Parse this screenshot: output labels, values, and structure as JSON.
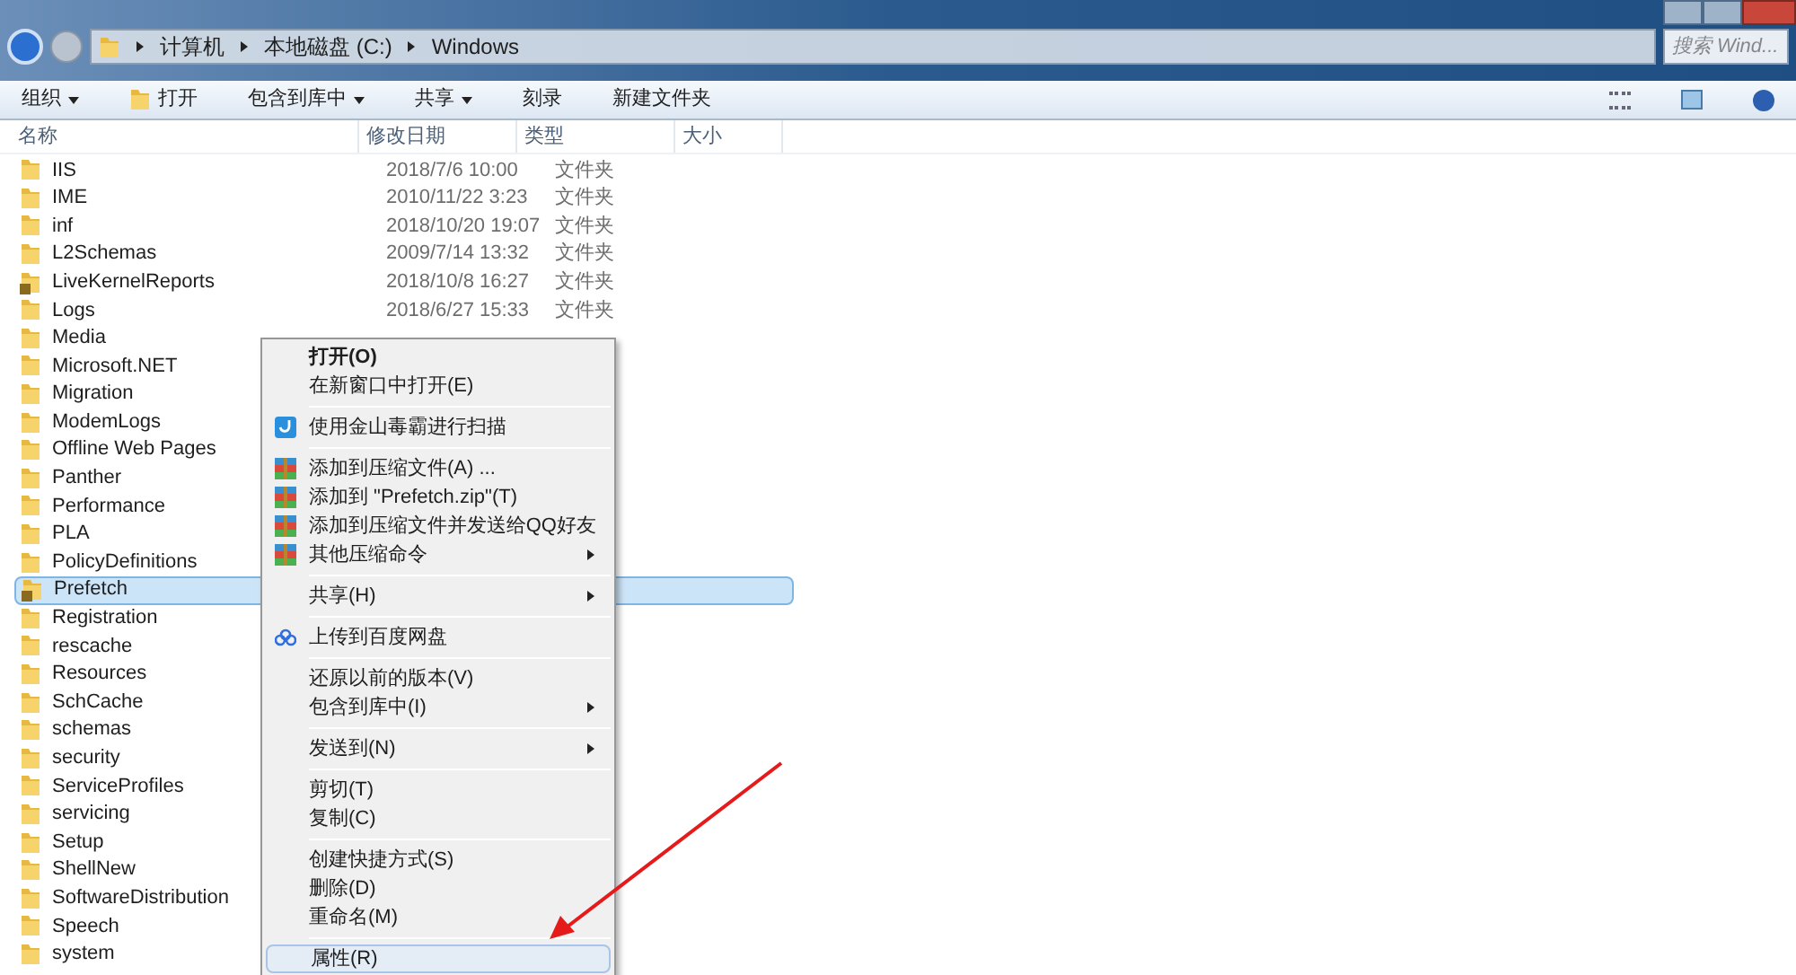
{
  "breadcrumb": [
    "计算机",
    "本地磁盘 (C:)",
    "Windows"
  ],
  "search": {
    "placeholder": "搜索 Wind..."
  },
  "toolbar": [
    {
      "label": "组织",
      "dropdown": true,
      "icon": false
    },
    {
      "label": "打开",
      "dropdown": false,
      "icon": true
    },
    {
      "label": "包含到库中",
      "dropdown": true,
      "icon": false
    },
    {
      "label": "共享",
      "dropdown": true,
      "icon": false
    },
    {
      "label": "刻录",
      "dropdown": false,
      "icon": false
    },
    {
      "label": "新建文件夹",
      "dropdown": false,
      "icon": false
    }
  ],
  "columns": [
    "名称",
    "修改日期",
    "类型",
    "大小"
  ],
  "rows": [
    {
      "name": "IIS",
      "date": "2018/7/6 10:00",
      "type": "文件夹",
      "locked": false,
      "selected": false
    },
    {
      "name": "IME",
      "date": "2010/11/22 3:23",
      "type": "文件夹",
      "locked": false,
      "selected": false
    },
    {
      "name": "inf",
      "date": "2018/10/20 19:07",
      "type": "文件夹",
      "locked": false,
      "selected": false
    },
    {
      "name": "L2Schemas",
      "date": "2009/7/14 13:32",
      "type": "文件夹",
      "locked": false,
      "selected": false
    },
    {
      "name": "LiveKernelReports",
      "date": "2018/10/8 16:27",
      "type": "文件夹",
      "locked": true,
      "selected": false
    },
    {
      "name": "Logs",
      "date": "2018/6/27 15:33",
      "type": "文件夹",
      "locked": false,
      "selected": false
    },
    {
      "name": "Media",
      "locked": false,
      "selected": false
    },
    {
      "name": "Microsoft.NET",
      "locked": false,
      "selected": false
    },
    {
      "name": "Migration",
      "locked": false,
      "selected": false
    },
    {
      "name": "ModemLogs",
      "locked": false,
      "selected": false
    },
    {
      "name": "Offline Web Pages",
      "locked": false,
      "selected": false
    },
    {
      "name": "Panther",
      "locked": false,
      "selected": false
    },
    {
      "name": "Performance",
      "locked": false,
      "selected": false
    },
    {
      "name": "PLA",
      "locked": false,
      "selected": false
    },
    {
      "name": "PolicyDefinitions",
      "locked": false,
      "selected": false
    },
    {
      "name": "Prefetch",
      "locked": true,
      "selected": true
    },
    {
      "name": "Registration",
      "locked": false,
      "selected": false
    },
    {
      "name": "rescache",
      "locked": false,
      "selected": false
    },
    {
      "name": "Resources",
      "locked": false,
      "selected": false
    },
    {
      "name": "SchCache",
      "locked": false,
      "selected": false
    },
    {
      "name": "schemas",
      "locked": false,
      "selected": false
    },
    {
      "name": "security",
      "locked": false,
      "selected": false
    },
    {
      "name": "ServiceProfiles",
      "locked": false,
      "selected": false
    },
    {
      "name": "servicing",
      "locked": false,
      "selected": false
    },
    {
      "name": "Setup",
      "locked": false,
      "selected": false
    },
    {
      "name": "ShellNew",
      "locked": false,
      "selected": false
    },
    {
      "name": "SoftwareDistribution",
      "locked": false,
      "selected": false
    },
    {
      "name": "Speech",
      "locked": false,
      "selected": false
    },
    {
      "name": "system",
      "locked": false,
      "selected": false
    }
  ],
  "context_menu": {
    "groups": [
      [
        {
          "label": "打开(O)",
          "bold": true,
          "kind": "plain",
          "submenu": false,
          "selected": false
        },
        {
          "label": "在新窗口中打开(E)",
          "bold": false,
          "kind": "plain",
          "submenu": false,
          "selected": false
        }
      ],
      [
        {
          "label": "使用金山毒霸进行扫描",
          "bold": false,
          "kind": "scan",
          "submenu": false,
          "selected": false
        }
      ],
      [
        {
          "label": "添加到压缩文件(A) ...",
          "bold": false,
          "kind": "archive",
          "submenu": false,
          "selected": false
        },
        {
          "label": "添加到 \"Prefetch.zip\"(T)",
          "bold": false,
          "kind": "archive",
          "submenu": false,
          "selected": false
        },
        {
          "label": "添加到压缩文件并发送给QQ好友",
          "bold": false,
          "kind": "archive",
          "submenu": false,
          "selected": false
        },
        {
          "label": "其他压缩命令",
          "bold": false,
          "kind": "archive",
          "submenu": true,
          "selected": false
        }
      ],
      [
        {
          "label": "共享(H)",
          "bold": false,
          "kind": "plain",
          "submenu": true,
          "selected": false
        }
      ],
      [
        {
          "label": "上传到百度网盘",
          "bold": false,
          "kind": "cloud",
          "submenu": false,
          "selected": false
        }
      ],
      [
        {
          "label": "还原以前的版本(V)",
          "bold": false,
          "kind": "plain",
          "submenu": false,
          "selected": false
        },
        {
          "label": "包含到库中(I)",
          "bold": false,
          "kind": "plain",
          "submenu": true,
          "selected": false
        }
      ],
      [
        {
          "label": "发送到(N)",
          "bold": false,
          "kind": "plain",
          "submenu": true,
          "selected": false
        }
      ],
      [
        {
          "label": "剪切(T)",
          "bold": false,
          "kind": "plain",
          "submenu": false,
          "selected": false
        },
        {
          "label": "复制(C)",
          "bold": false,
          "kind": "plain",
          "submenu": false,
          "selected": false
        }
      ],
      [
        {
          "label": "创建快捷方式(S)",
          "bold": false,
          "kind": "plain",
          "submenu": false,
          "selected": false
        },
        {
          "label": "删除(D)",
          "bold": false,
          "kind": "plain",
          "submenu": false,
          "selected": false
        },
        {
          "label": "重命名(M)",
          "bold": false,
          "kind": "plain",
          "submenu": false,
          "selected": false
        }
      ],
      [
        {
          "label": "属性(R)",
          "bold": false,
          "kind": "plain",
          "submenu": false,
          "selected": true
        }
      ]
    ]
  }
}
